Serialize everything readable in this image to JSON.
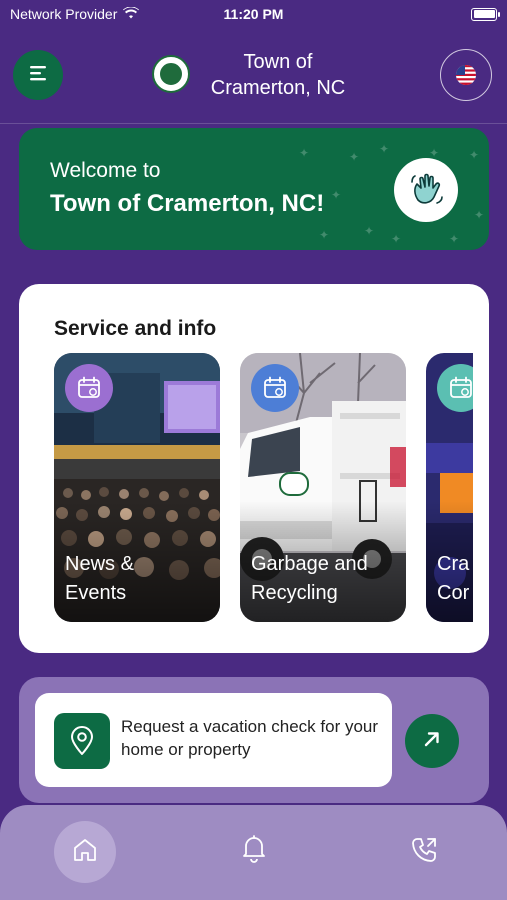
{
  "status_bar": {
    "carrier": "Network Provider",
    "time": "11:20 PM",
    "icons": [
      "wifi-icon",
      "battery-icon"
    ]
  },
  "header": {
    "title_line1": "Town of",
    "title_line2": "Cramerton, NC",
    "menu_icon": "hamburger-menu-icon",
    "language_icon": "us-flag-icon"
  },
  "welcome": {
    "line1": "Welcome to",
    "line2": "Town of Cramerton, NC!",
    "icon": "waving-hand-icon"
  },
  "services": {
    "title": "Service and info",
    "items": [
      {
        "label": "News &\nEvents",
        "icon": "calendar-icon",
        "badge_color": "#9b6fd1"
      },
      {
        "label": "Garbage and\nRecycling",
        "icon": "calendar-icon",
        "badge_color": "#4d7ed6"
      },
      {
        "label": "Cra\nCor",
        "icon": "calendar-icon",
        "badge_color": "#5bbfb2"
      }
    ]
  },
  "vacation": {
    "text": "Request a vacation check for your home or property",
    "icon": "map-pin-icon",
    "action_icon": "arrow-up-right-icon"
  },
  "bottom_nav": {
    "items": [
      "home-icon",
      "bell-icon",
      "phone-call-icon"
    ],
    "active": "home-icon"
  },
  "colors": {
    "background": "#4a2a82",
    "brand_green": "#0d6b44",
    "card_lavender": "#8b73b6",
    "nav_background": "#9e8cc2"
  }
}
